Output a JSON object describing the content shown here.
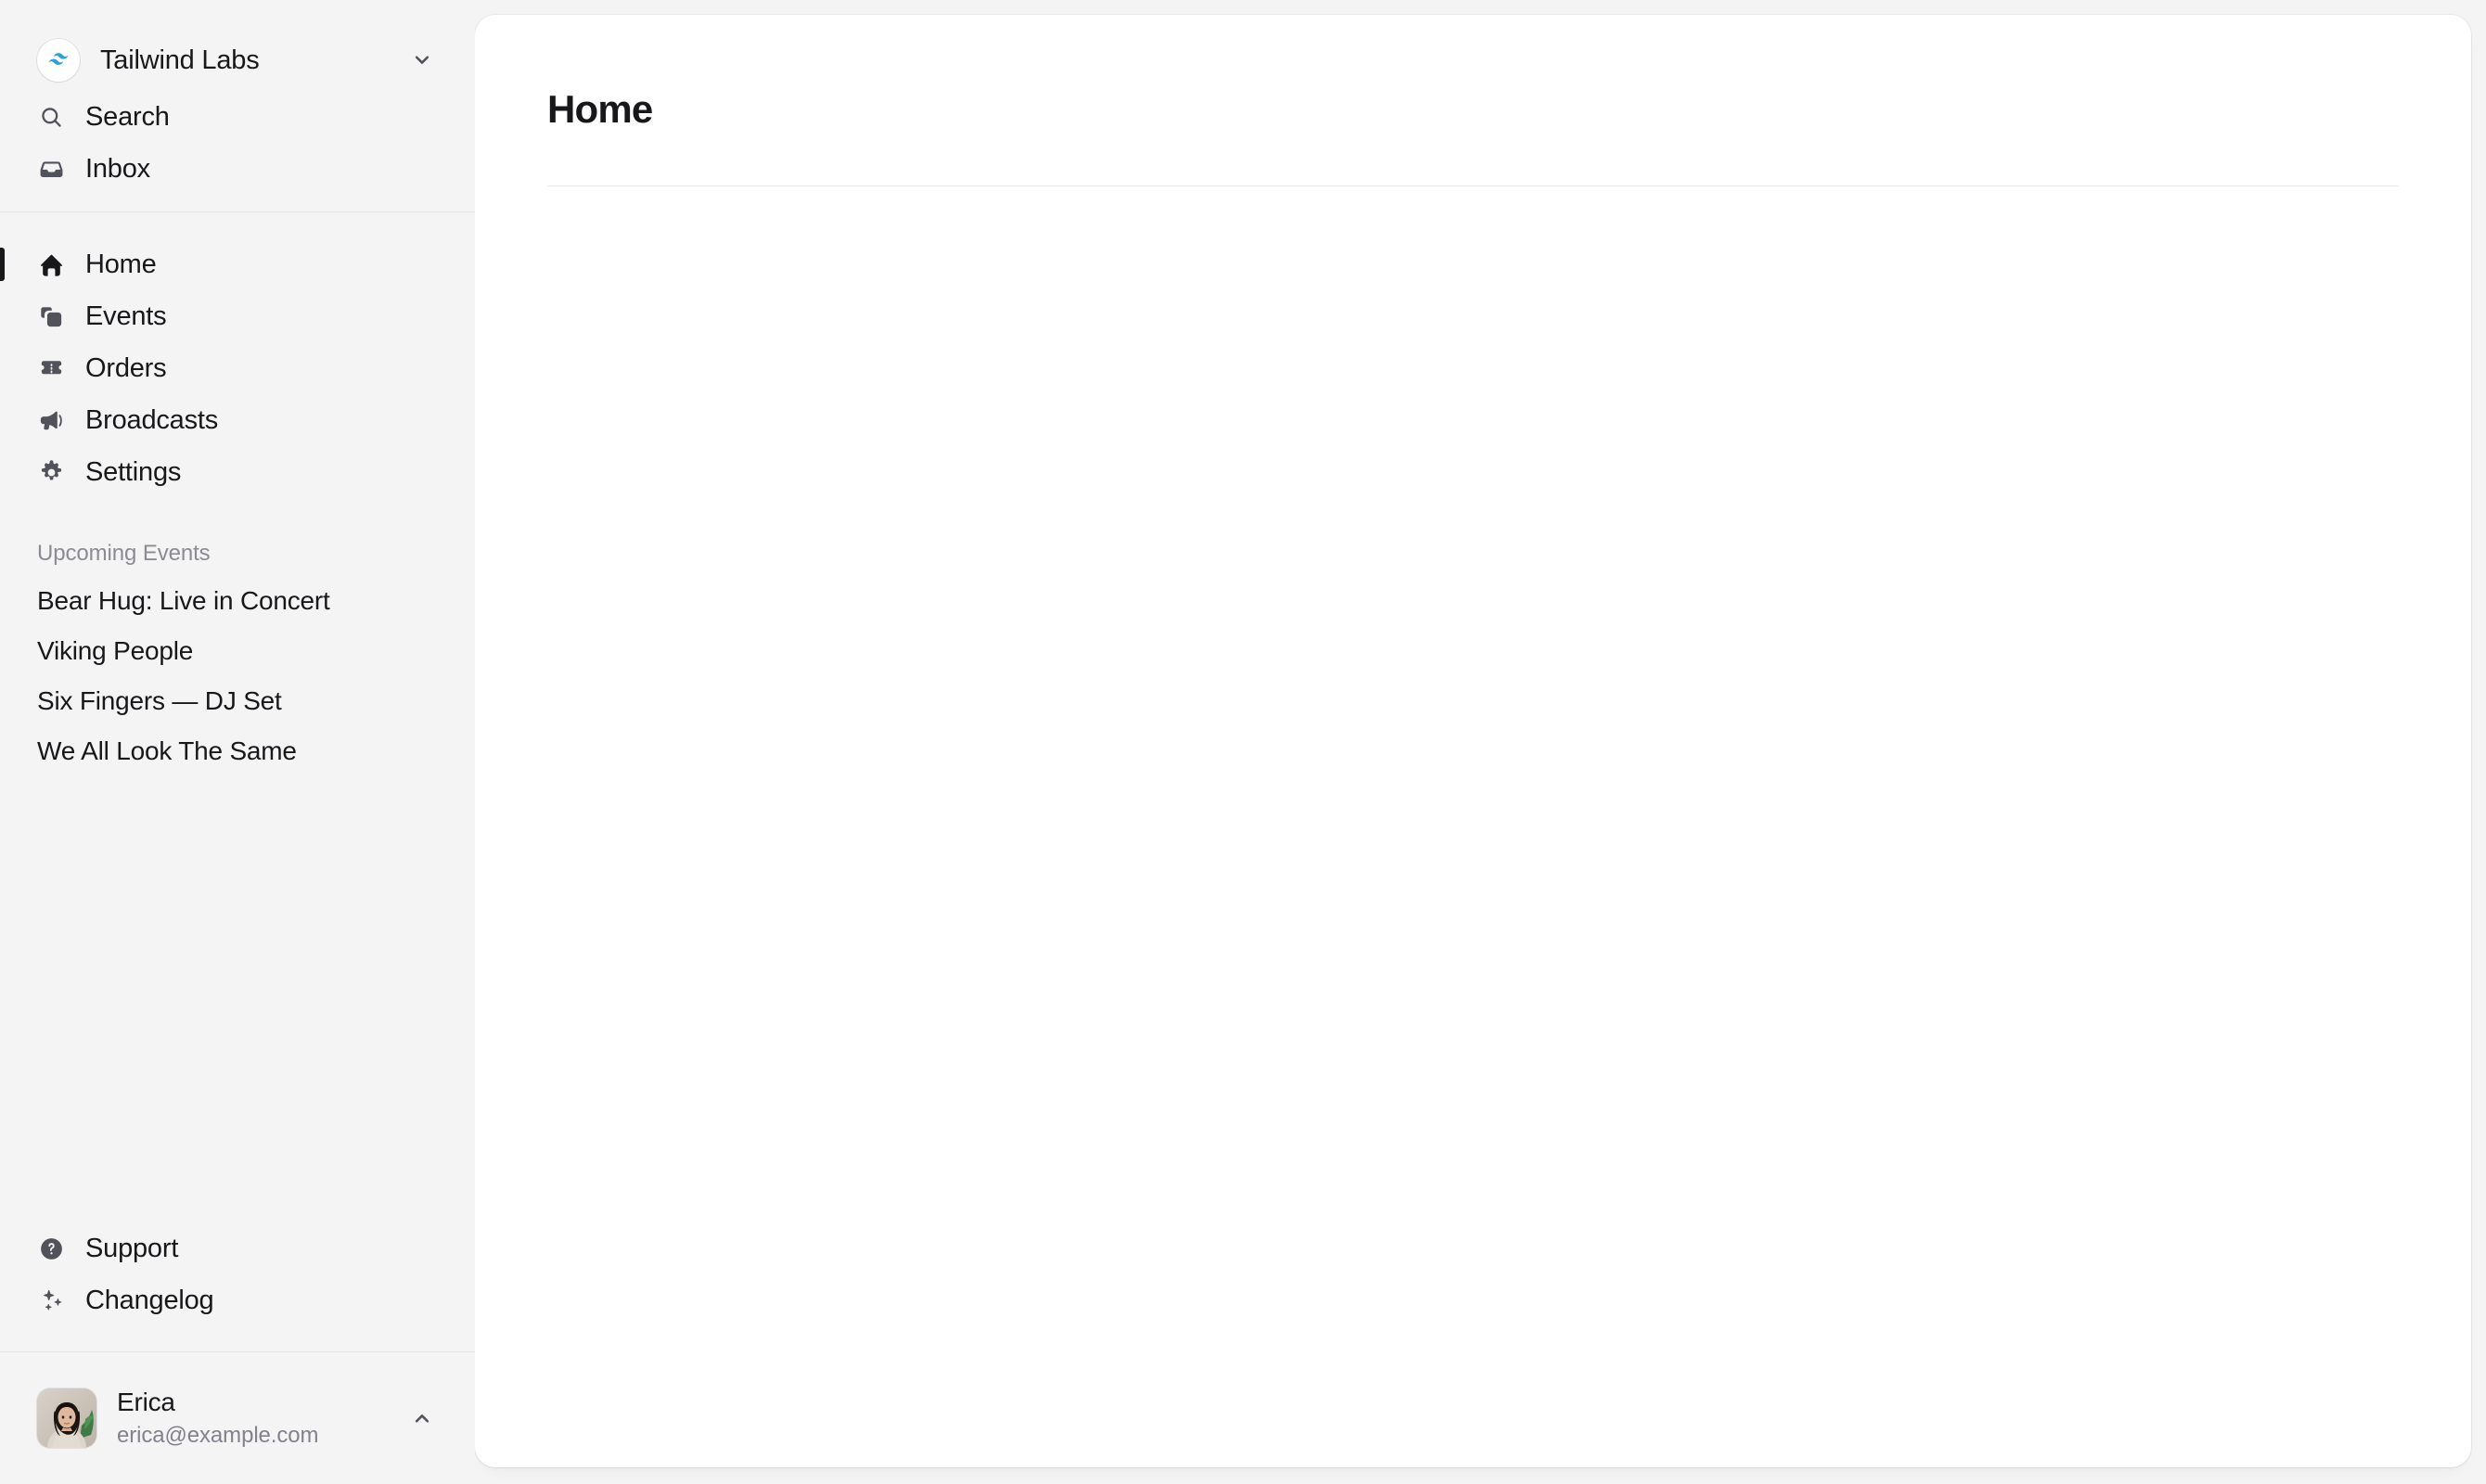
{
  "colors": {
    "sidebar_bg": "#f4f4f5",
    "panel_bg": "#ffffff",
    "text_primary": "#18181b",
    "text_muted": "#82828c",
    "icon": "#52525b",
    "divider": "#e4e4e7",
    "brand_logo": "#38bdf8",
    "active_marker": "#18181b"
  },
  "sidebar": {
    "org": {
      "name": "Tailwind Labs",
      "logo_icon": "tailwind-logo-icon",
      "chevron_icon": "chevron-down-icon"
    },
    "top_items": [
      {
        "label": "Search",
        "icon": "search-icon"
      },
      {
        "label": "Inbox",
        "icon": "inbox-icon"
      }
    ],
    "main_items": [
      {
        "label": "Home",
        "icon": "home-icon",
        "active": true
      },
      {
        "label": "Events",
        "icon": "squares-stack-icon",
        "active": false
      },
      {
        "label": "Orders",
        "icon": "ticket-icon",
        "active": false
      },
      {
        "label": "Broadcasts",
        "icon": "megaphone-icon",
        "active": false
      },
      {
        "label": "Settings",
        "icon": "gear-icon",
        "active": false
      }
    ],
    "upcoming": {
      "heading": "Upcoming Events",
      "items": [
        {
          "label": "Bear Hug: Live in Concert"
        },
        {
          "label": "Viking People"
        },
        {
          "label": "Six Fingers — DJ Set"
        },
        {
          "label": "We All Look The Same"
        }
      ]
    },
    "footer_items": [
      {
        "label": "Support",
        "icon": "question-mark-circle-icon"
      },
      {
        "label": "Changelog",
        "icon": "sparkles-icon"
      }
    ],
    "user": {
      "name": "Erica",
      "email": "erica@example.com",
      "avatar_icon": "user-avatar-photo",
      "chevron_icon": "chevron-up-icon"
    }
  },
  "main": {
    "title": "Home"
  }
}
